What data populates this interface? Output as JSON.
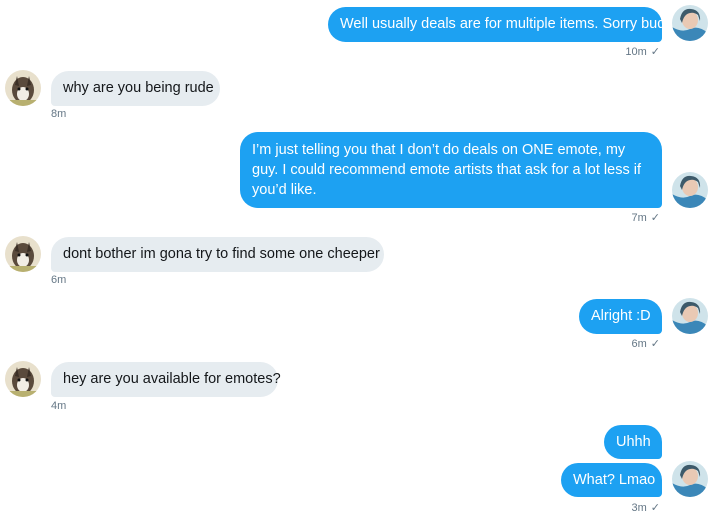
{
  "conversation": {
    "messages": [
      {
        "direction": "outgoing",
        "text": "Well usually deals are for multiple items. Sorry bud.",
        "time": "10m",
        "seen": true
      },
      {
        "direction": "incoming",
        "text": "why are you being rude",
        "time": "8m"
      },
      {
        "direction": "outgoing",
        "text": "I’m just telling you that I don’t do deals on ONE emote, my guy. I could recommend emote artists that ask for a lot less if you’d like.",
        "time": "7m",
        "seen": true
      },
      {
        "direction": "incoming",
        "text": "dont bother im gona try to find some one cheeper",
        "time": "6m"
      },
      {
        "direction": "outgoing",
        "text": "Alright :D",
        "time": "6m",
        "seen": true
      },
      {
        "direction": "incoming",
        "text": "hey are you available for emotes?",
        "time": "4m"
      },
      {
        "direction": "outgoing",
        "text": "Uhhh"
      },
      {
        "direction": "outgoing",
        "text": "What? Lmao",
        "time": "3m",
        "seen": true
      }
    ]
  },
  "icons": {
    "seen": "checkmark-icon",
    "self_avatar": "self-avatar",
    "other_avatar": "contact-avatar"
  },
  "colors": {
    "outgoing_bubble": "#1da1f2",
    "incoming_bubble": "#e6ecf0",
    "meta_text": "#657786"
  }
}
